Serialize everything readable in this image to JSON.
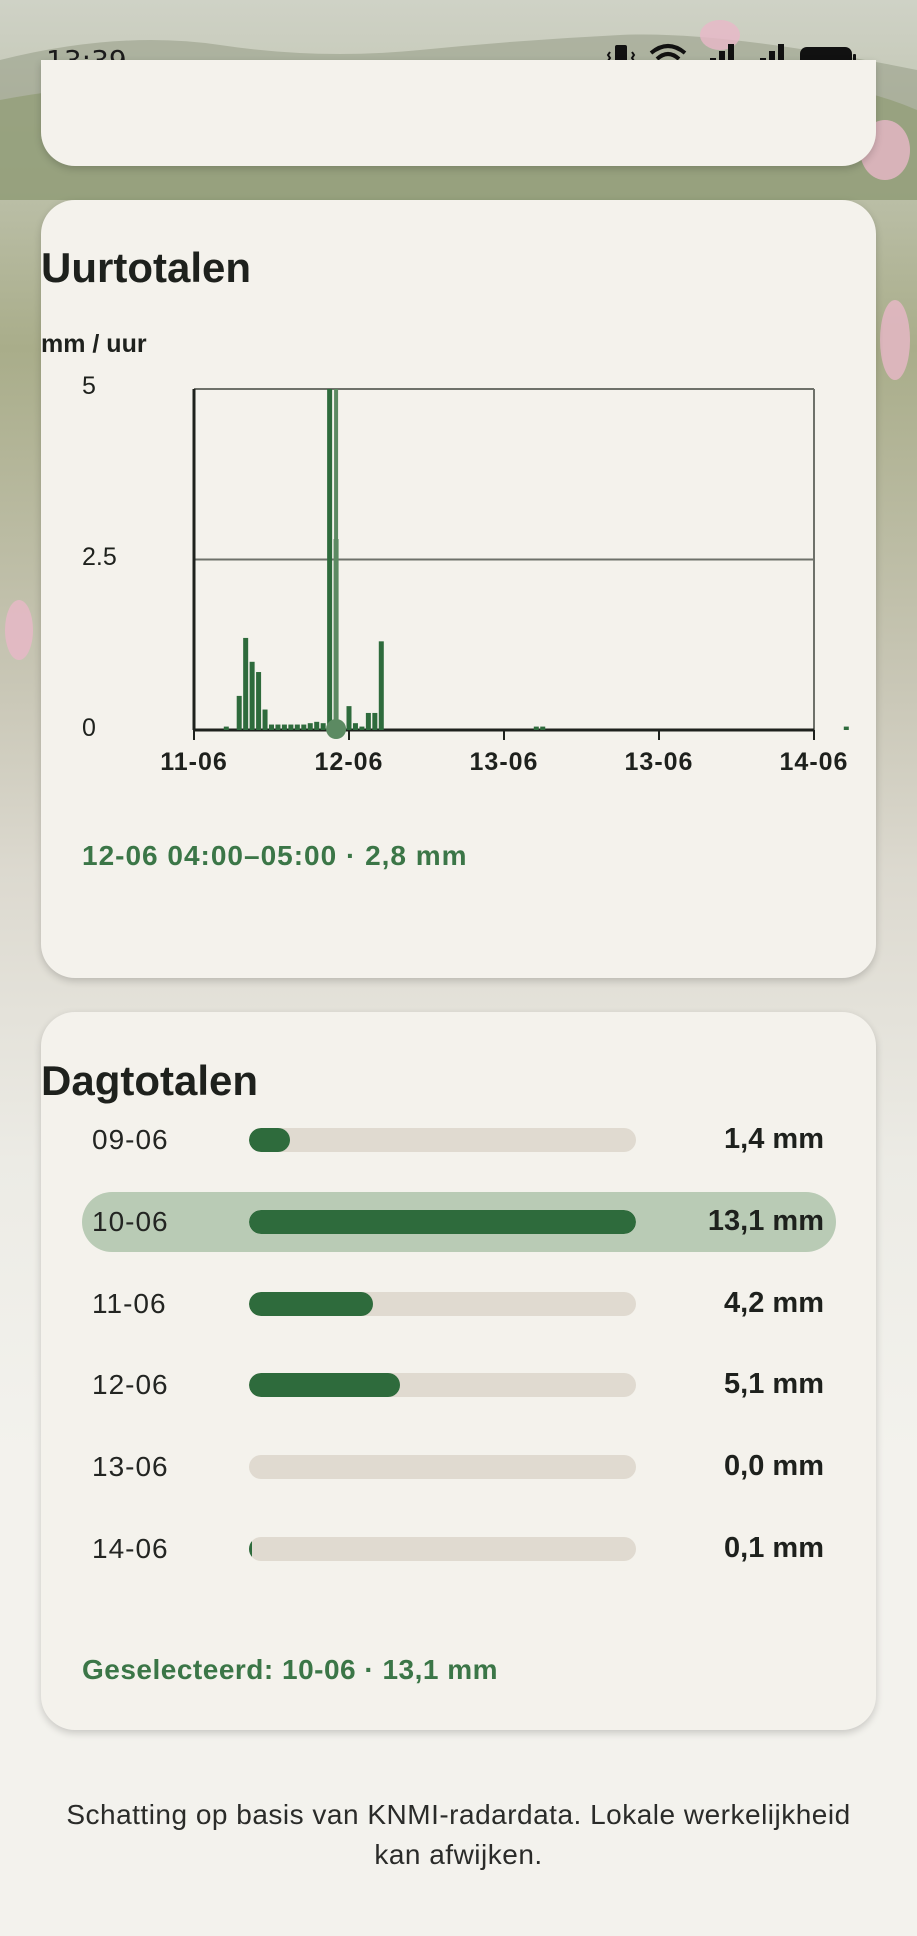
{
  "status_bar": {
    "time": "13:39",
    "icons": [
      "vibrate-icon",
      "wifi-icon",
      "signal-icon",
      "signal-icon",
      "battery-icon"
    ]
  },
  "uurtotalen": {
    "title": "Uurtotalen",
    "unit": "mm / uur",
    "selection": "12-06 04:00–05:00 · 2,8 mm",
    "chart_data": {
      "type": "bar",
      "ylabel": "mm / uur",
      "ylim": [
        0,
        5
      ],
      "yticks": [
        "5",
        "2.5",
        "0"
      ],
      "xticks": [
        "11-06",
        "12-06",
        "13-06",
        "13-06",
        "14-06"
      ],
      "x_hours": [
        5,
        7,
        8,
        9,
        10,
        11,
        12,
        13,
        14,
        15,
        16,
        17,
        18,
        19,
        20,
        21,
        22,
        24,
        25,
        26,
        27,
        28,
        29,
        53,
        54,
        101
      ],
      "values": [
        0.05,
        0.5,
        1.35,
        1.0,
        0.85,
        0.3,
        0.08,
        0.08,
        0.08,
        0.08,
        0.08,
        0.08,
        0.1,
        0.12,
        0.1,
        5.0,
        2.8,
        0.35,
        0.1,
        0.05,
        0.25,
        0.25,
        1.3,
        0.05,
        0.05,
        0.05
      ],
      "highlight_index": 16,
      "grid": true,
      "colors": {
        "bar": "#2e6b3c",
        "highlight": "#5c8a62",
        "axis": "#1e211d",
        "grid": "#6e716a"
      }
    }
  },
  "dagtotalen": {
    "title": "Dagtotalen",
    "days": [
      {
        "date": "09-06",
        "amount": "1,4 mm",
        "value": 1.4
      },
      {
        "date": "10-06",
        "amount": "13,1 mm",
        "value": 13.1,
        "selected": true
      },
      {
        "date": "11-06",
        "amount": "4,2 mm",
        "value": 4.2
      },
      {
        "date": "12-06",
        "amount": "5,1 mm",
        "value": 5.1
      },
      {
        "date": "13-06",
        "amount": "0,0 mm",
        "value": 0.0
      },
      {
        "date": "14-06",
        "amount": "0,1 mm",
        "value": 0.1
      }
    ],
    "selected_text": "Geselecteerd: 10-06 · 13,1 mm"
  },
  "footer": "Schatting op basis van KNMI-radardata. Lokale werkelijkheid kan afwijken."
}
